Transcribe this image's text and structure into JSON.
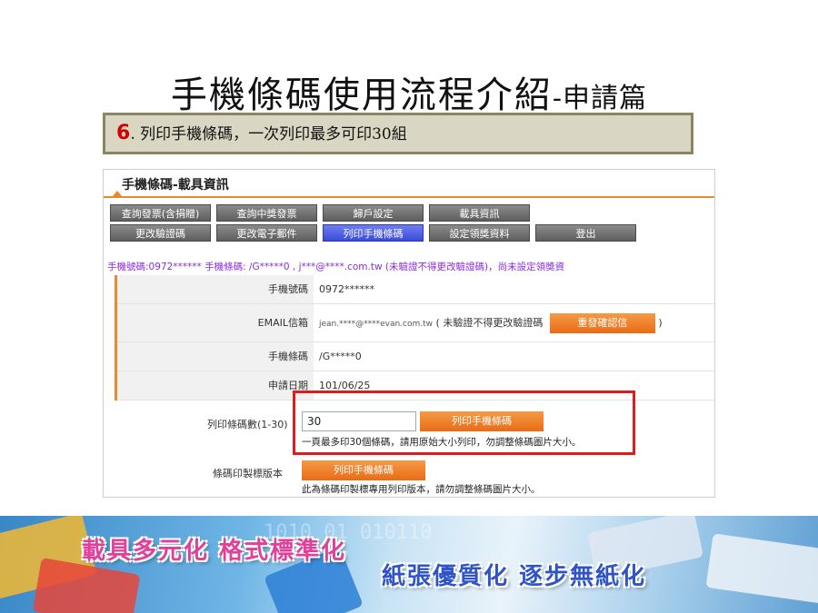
{
  "slide": {
    "title_main": "手機條碼使用流程介紹",
    "title_sub": "-申請篇",
    "step_number": "6",
    "step_text": ". 列印手機條碼，一次列印最多可印30組"
  },
  "web": {
    "header_title": "手機條碼-載具資訊",
    "nav": [
      {
        "label": "查詢發票(含捐贈)"
      },
      {
        "label": "查詢中獎發票"
      },
      {
        "label": "歸戶設定"
      },
      {
        "label": "載具資訊"
      },
      {
        "label": "更改驗證碼"
      },
      {
        "label": "更改電子郵件"
      },
      {
        "label": "列印手機條碼"
      },
      {
        "label": "設定領獎資料"
      },
      {
        "label": "登出"
      }
    ],
    "notice": "手機號碼:0972****** 手機條碼: /G*****0 , j***@****.com.tw (未驗證不得更改驗證碼)，尚未設定領獎資",
    "rows": [
      {
        "label": "手機號碼",
        "value": "0972******"
      },
      {
        "label": "EMAIL信箱",
        "value": "jean.****@****evan.com.tw",
        "note": "( 未驗證不得更改驗證碼",
        "button": "重發確認信",
        "close": ")"
      },
      {
        "label": "手機條碼",
        "value": "/G*****0"
      },
      {
        "label": "申請日期",
        "value": "101/06/25"
      }
    ],
    "print": {
      "label": "列印條碼數(1-30)",
      "value": "30",
      "button": "列印手機條碼",
      "hint": "一頁最多印30個條碼，請用原始大小列印，勿調整條碼圖片大小。"
    },
    "print_alt": {
      "label": "條碼印製標版本",
      "button": "列印手機條碼",
      "hint": "此為條碼印製標專用列印版本，請勿調整條碼圖片大小。"
    }
  },
  "banner": {
    "line1": "載具多元化 格式標準化",
    "line2": "紙張優質化 逐步無紙化",
    "binary": "1010  01 010110"
  },
  "colors": {
    "accent_orange": "#ea6b16",
    "highlight_red": "#e01b1b",
    "step_number_red": "#d40000",
    "nav_active": "#3a4bd8",
    "notice_purple": "#8a2be2"
  }
}
